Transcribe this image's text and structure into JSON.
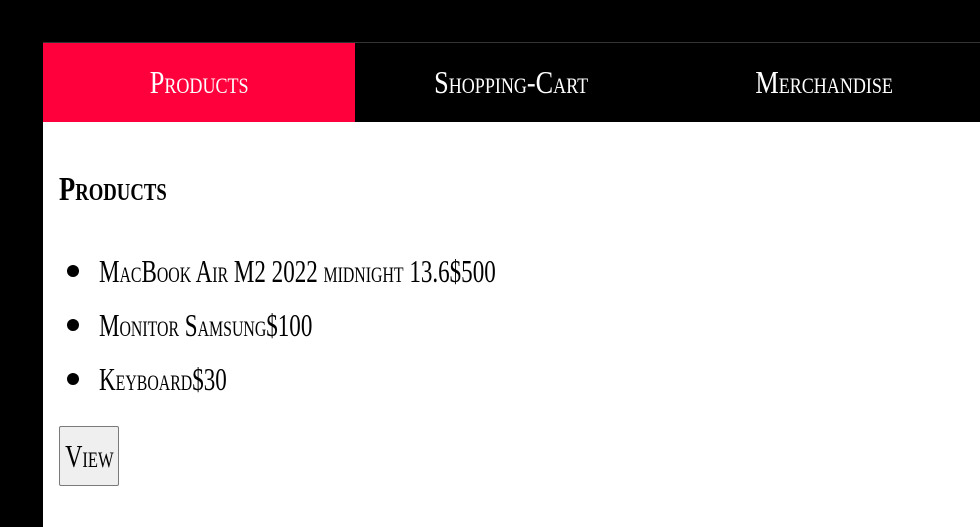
{
  "nav": {
    "tabs": [
      {
        "label": "Products",
        "active": true
      },
      {
        "label": "Shopping-Cart",
        "active": false
      },
      {
        "label": "Merchandise",
        "active": false
      }
    ]
  },
  "colors": {
    "active_tab": "#ff003c",
    "nav_background": "#000000",
    "page_background": "#000000",
    "content_background": "#ffffff"
  },
  "main": {
    "title": "Products",
    "items": [
      {
        "name": "MacBook Air M2 2022 midnight 13.6",
        "price": "$500"
      },
      {
        "name": "Monitor Samsung",
        "price": "$100"
      },
      {
        "name": "Keyboard",
        "price": "$30"
      }
    ],
    "view_label": "View"
  }
}
